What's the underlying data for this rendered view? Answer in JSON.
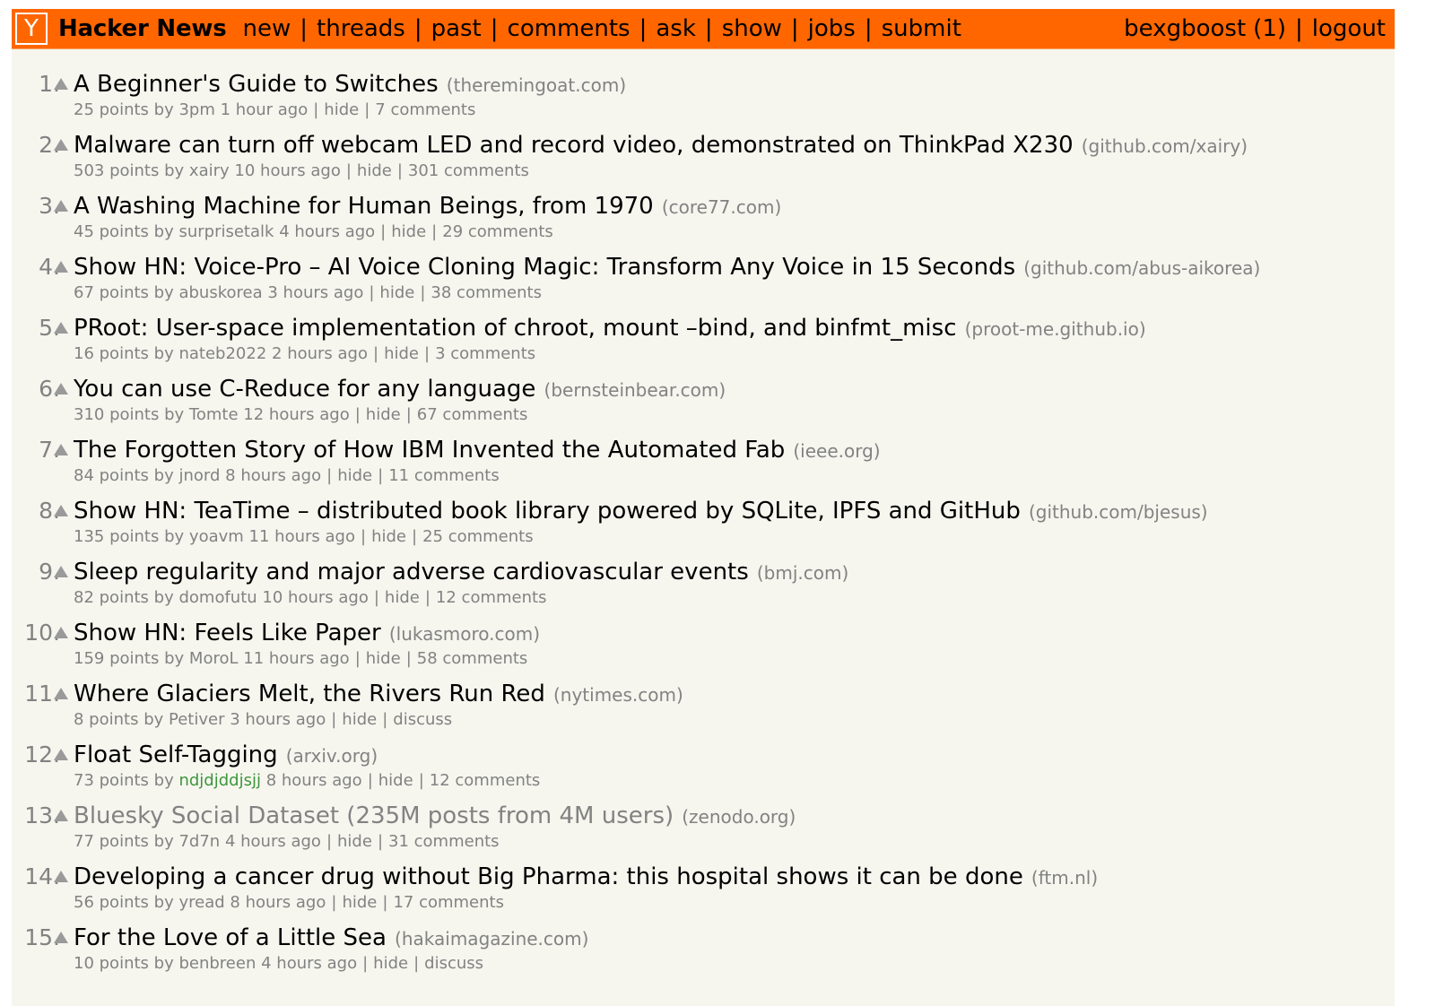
{
  "header": {
    "logo_letter": "Y",
    "brand": "Hacker News",
    "nav": [
      {
        "label": "new"
      },
      {
        "label": "threads"
      },
      {
        "label": "past"
      },
      {
        "label": "comments"
      },
      {
        "label": "ask"
      },
      {
        "label": "show"
      },
      {
        "label": "jobs"
      },
      {
        "label": "submit"
      }
    ],
    "separator": "|",
    "user": {
      "name": "bexgboost",
      "karma": "(1)",
      "logout": "logout"
    }
  },
  "colors": {
    "header_bg": "#ff6600",
    "page_bg": "#f6f6ef",
    "muted": "#828282",
    "new_user": "#3c963c"
  },
  "icons": {
    "upvote": "upvote-triangle-icon"
  },
  "stories": [
    {
      "rank": "1.",
      "title": "A Beginner's Guide to Switches",
      "site": "(theremingoat.com)",
      "points": "25 points",
      "by": "by",
      "user": "3pm",
      "age": "1 hour ago",
      "hide": "hide",
      "comments": "7 comments",
      "visited": false,
      "new_user": false
    },
    {
      "rank": "2.",
      "title": "Malware can turn off webcam LED and record video, demonstrated on ThinkPad X230",
      "site": "(github.com/xairy)",
      "points": "503 points",
      "by": "by",
      "user": "xairy",
      "age": "10 hours ago",
      "hide": "hide",
      "comments": "301 comments",
      "visited": false,
      "new_user": false
    },
    {
      "rank": "3.",
      "title": "A Washing Machine for Human Beings, from 1970",
      "site": "(core77.com)",
      "points": "45 points",
      "by": "by",
      "user": "surprisetalk",
      "age": "4 hours ago",
      "hide": "hide",
      "comments": "29 comments",
      "visited": false,
      "new_user": false
    },
    {
      "rank": "4.",
      "title": "Show HN: Voice-Pro – AI Voice Cloning Magic: Transform Any Voice in 15 Seconds",
      "site": "(github.com/abus-aikorea)",
      "points": "67 points",
      "by": "by",
      "user": "abuskorea",
      "age": "3 hours ago",
      "hide": "hide",
      "comments": "38 comments",
      "visited": false,
      "new_user": false
    },
    {
      "rank": "5.",
      "title": "PRoot: User-space implementation of chroot, mount –bind, and binfmt_misc",
      "site": "(proot-me.github.io)",
      "points": "16 points",
      "by": "by",
      "user": "nateb2022",
      "age": "2 hours ago",
      "hide": "hide",
      "comments": "3 comments",
      "visited": false,
      "new_user": false
    },
    {
      "rank": "6.",
      "title": "You can use C-Reduce for any language",
      "site": "(bernsteinbear.com)",
      "points": "310 points",
      "by": "by",
      "user": "Tomte",
      "age": "12 hours ago",
      "hide": "hide",
      "comments": "67 comments",
      "visited": false,
      "new_user": false
    },
    {
      "rank": "7.",
      "title": "The Forgotten Story of How IBM Invented the Automated Fab",
      "site": "(ieee.org)",
      "points": "84 points",
      "by": "by",
      "user": "jnord",
      "age": "8 hours ago",
      "hide": "hide",
      "comments": "11 comments",
      "visited": false,
      "new_user": false
    },
    {
      "rank": "8.",
      "title": "Show HN: TeaTime – distributed book library powered by SQLite, IPFS and GitHub",
      "site": "(github.com/bjesus)",
      "points": "135 points",
      "by": "by",
      "user": "yoavm",
      "age": "11 hours ago",
      "hide": "hide",
      "comments": "25 comments",
      "visited": false,
      "new_user": false
    },
    {
      "rank": "9.",
      "title": "Sleep regularity and major adverse cardiovascular events",
      "site": "(bmj.com)",
      "points": "82 points",
      "by": "by",
      "user": "domofutu",
      "age": "10 hours ago",
      "hide": "hide",
      "comments": "12 comments",
      "visited": false,
      "new_user": false
    },
    {
      "rank": "10.",
      "title": "Show HN: Feels Like Paper",
      "site": "(lukasmoro.com)",
      "points": "159 points",
      "by": "by",
      "user": "MoroL",
      "age": "11 hours ago",
      "hide": "hide",
      "comments": "58 comments",
      "visited": false,
      "new_user": false
    },
    {
      "rank": "11.",
      "title": "Where Glaciers Melt, the Rivers Run Red",
      "site": "(nytimes.com)",
      "points": "8 points",
      "by": "by",
      "user": "Petiver",
      "age": "3 hours ago",
      "hide": "hide",
      "comments": "discuss",
      "visited": false,
      "new_user": false
    },
    {
      "rank": "12.",
      "title": "Float Self-Tagging",
      "site": "(arxiv.org)",
      "points": "73 points",
      "by": "by",
      "user": "ndjdjddjsjj",
      "age": "8 hours ago",
      "hide": "hide",
      "comments": "12 comments",
      "visited": false,
      "new_user": true
    },
    {
      "rank": "13.",
      "title": "Bluesky Social Dataset (235M posts from 4M users)",
      "site": "(zenodo.org)",
      "points": "77 points",
      "by": "by",
      "user": "7d7n",
      "age": "4 hours ago",
      "hide": "hide",
      "comments": "31 comments",
      "visited": true,
      "new_user": false
    },
    {
      "rank": "14.",
      "title": "Developing a cancer drug without Big Pharma: this hospital shows it can be done",
      "site": "(ftm.nl)",
      "points": "56 points",
      "by": "by",
      "user": "yread",
      "age": "8 hours ago",
      "hide": "hide",
      "comments": "17 comments",
      "visited": false,
      "new_user": false
    },
    {
      "rank": "15.",
      "title": "For the Love of a Little Sea",
      "site": "(hakaimagazine.com)",
      "points": "10 points",
      "by": "by",
      "user": "benbreen",
      "age": "4 hours ago",
      "hide": "hide",
      "comments": "discuss",
      "visited": false,
      "new_user": false
    }
  ]
}
